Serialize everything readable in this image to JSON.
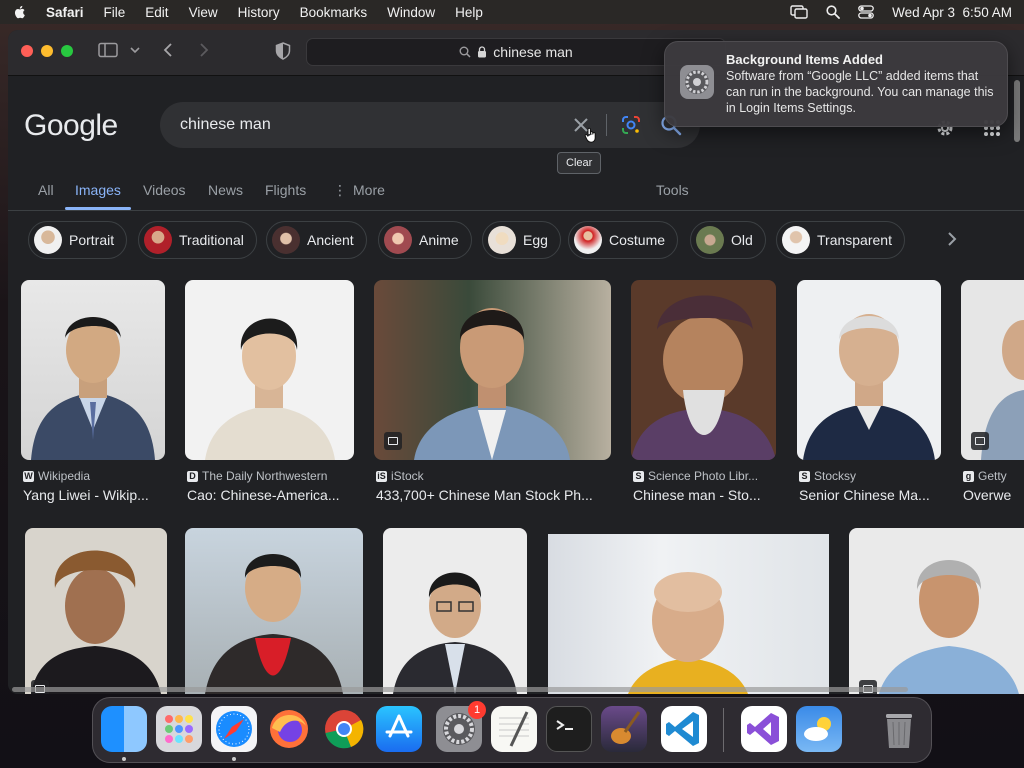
{
  "menubar": {
    "app_name": "Safari",
    "items": [
      "File",
      "Edit",
      "View",
      "History",
      "Bookmarks",
      "Window",
      "Help"
    ],
    "clock": "Wed Apr 3  6:50 AM"
  },
  "browser": {
    "url": "chinese man"
  },
  "google": {
    "logo": "Google",
    "query": "chinese man",
    "clear_tooltip": "Clear",
    "tabs": [
      "All",
      "Images",
      "Videos",
      "News",
      "Flights",
      "More"
    ],
    "active_tab": "Images",
    "tools_label": "Tools",
    "chips": [
      "Portrait",
      "Traditional",
      "Ancient",
      "Anime",
      "Egg",
      "Costume",
      "Old",
      "Transparent"
    ],
    "results_row1": [
      {
        "source": "Wikipedia",
        "fav": "W",
        "title": "Yang Liwei - Wikip..."
      },
      {
        "source": "The Daily Northwestern",
        "fav": "D",
        "title": "Cao: Chinese-America..."
      },
      {
        "source": "iStock",
        "fav": "iS",
        "title": "433,700+ Chinese Man Stock Ph..."
      },
      {
        "source": "Science Photo Libr...",
        "fav": "S",
        "title": "Chinese man - Sto..."
      },
      {
        "source": "Stocksy",
        "fav": "S",
        "title": "Senior Chinese Ma..."
      },
      {
        "source": "Getty",
        "fav": "g",
        "title": "Overwe"
      }
    ]
  },
  "notification": {
    "title": "Background Items Added",
    "body": "Software from “Google LLC” added items that can run in the background. You can manage this in Login Items Settings."
  },
  "dock": {
    "settings_badge": "1"
  }
}
